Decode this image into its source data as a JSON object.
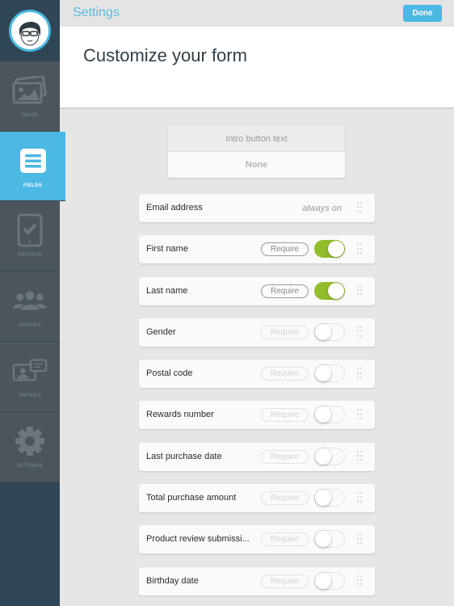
{
  "topbar": {
    "title": "Settings",
    "done_label": "Done"
  },
  "header": {
    "title": "Customize your form"
  },
  "sidebar": {
    "avatar_icon": "avatar-icon",
    "items": [
      {
        "label": "IMAGE",
        "icon": "image-icon",
        "active": false
      },
      {
        "label": "FIELDS",
        "icon": "list-icon",
        "active": true
      },
      {
        "label": "PREVIEW",
        "icon": "tablet-check-icon",
        "active": false
      },
      {
        "label": "GROUPS",
        "icon": "people-icon",
        "active": false
      },
      {
        "label": "ENTRIES",
        "icon": "entries-icon",
        "active": false
      },
      {
        "label": "SETTINGS",
        "icon": "gear-icon",
        "active": false
      }
    ]
  },
  "intro": {
    "label": "Intro button text",
    "value": "None"
  },
  "fields": [
    {
      "name": "Email address",
      "always_on": "always on"
    },
    {
      "name": "First name",
      "require_label": "Require",
      "enabled": true
    },
    {
      "name": "Last name",
      "require_label": "Require",
      "enabled": true
    },
    {
      "name": "Gender",
      "require_label": "Require",
      "enabled": false
    },
    {
      "name": "Postal code",
      "require_label": "Require",
      "enabled": false
    },
    {
      "name": "Rewards number",
      "require_label": "Require",
      "enabled": false
    },
    {
      "name": "Last purchase date",
      "require_label": "Require",
      "enabled": false
    },
    {
      "name": "Total purchase amount",
      "require_label": "Require",
      "enabled": false
    },
    {
      "name": "Product review submissi...",
      "require_label": "Require",
      "enabled": false
    },
    {
      "name": "Birthday date",
      "require_label": "Require",
      "enabled": false
    }
  ],
  "colors": {
    "accent": "#4cb8e4",
    "toggle_on": "#93bd2a",
    "sidebar": "#2f4656"
  }
}
